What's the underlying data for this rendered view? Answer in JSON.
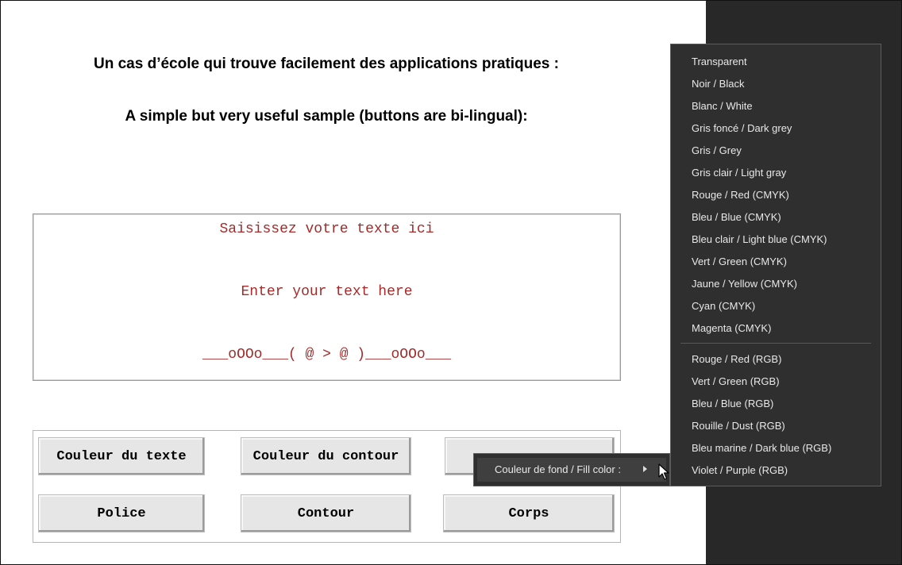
{
  "headings": {
    "line1": "Un cas d’école qui trouve facilement des applications pratiques :",
    "line2": "A simple but very useful sample (buttons are bi-lingual):"
  },
  "textbox": {
    "line1": "Saisissez votre texte ici",
    "line2": "Enter your text here",
    "line3": "___oOOo___( @ > @ )___oOOo___"
  },
  "buttons": {
    "text_color": "Couleur du texte",
    "outline_color": "Couleur du contour",
    "font": "Police",
    "outline": "Contour",
    "body": "Corps"
  },
  "context_menu": {
    "fill_color": "Couleur de fond / Fill color :"
  },
  "submenu": {
    "cmyk": [
      "Transparent",
      "Noir / Black",
      "Blanc / White",
      "Gris foncé / Dark grey",
      "Gris / Grey",
      "Gris clair / Light gray",
      "Rouge / Red (CMYK)",
      "Bleu / Blue (CMYK)",
      "Bleu clair / Light blue (CMYK)",
      "Vert / Green (CMYK)",
      "Jaune / Yellow (CMYK)",
      "Cyan (CMYK)",
      "Magenta (CMYK)"
    ],
    "rgb": [
      "Rouge / Red (RGB)",
      "Vert / Green (RGB)",
      "Bleu / Blue (RGB)",
      "Rouille / Dust (RGB)",
      "Bleu marine / Dark blue (RGB)",
      "Violet / Purple (RGB)"
    ]
  },
  "colors": {
    "sample_text": "#a52a2a",
    "menu_bg": "#2f2f2f",
    "menu_text": "#e8e8e8",
    "dark_area": "#282828"
  }
}
